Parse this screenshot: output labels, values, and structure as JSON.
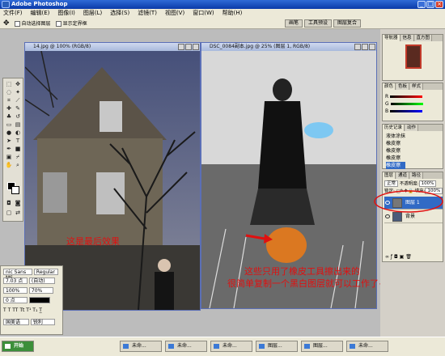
{
  "app": {
    "title": "Adobe Photoshop"
  },
  "menu": [
    "文件(F)",
    "编辑(E)",
    "图像(I)",
    "图层(L)",
    "选择(S)",
    "滤镜(T)",
    "视图(V)",
    "窗口(W)",
    "帮助(H)"
  ],
  "options_bar": {
    "option1": "自动选择图层",
    "option2": "显示定界框"
  },
  "palette_well": [
    "画笔",
    "工具预设",
    "图层复合"
  ],
  "documents": [
    {
      "title": "14.jpg @ 100% (RGB/8)"
    },
    {
      "title": "DSC_0084副本.jpg @ 25% (图层 1, RGB/8)"
    }
  ],
  "captions": {
    "left": "这是最后效果",
    "right_line1": "这些只用了橡皮工具擦出来的",
    "right_line2": "很简单复制一个黑白图层就可以工作了~"
  },
  "character_panel": {
    "font": "nic Sans MS",
    "style": "Regular",
    "size": "7.03 点",
    "leading": "(自动)",
    "scale_v": "100%",
    "scale_h": "70%",
    "baseline": "0 点",
    "lang": "国美语",
    "aa": "锐利"
  },
  "navigator": {
    "tabs": [
      "导航器",
      "信息",
      "直方图"
    ]
  },
  "color_panel": {
    "tabs": [
      "颜色",
      "色板",
      "样式"
    ],
    "channels": [
      "R",
      "G",
      "B"
    ]
  },
  "history_panel": {
    "tabs": [
      "历史记录",
      "动作"
    ],
    "items": [
      "液体涂抹",
      "橡皮擦",
      "橡皮擦",
      "橡皮擦",
      "橡皮擦"
    ]
  },
  "layers_panel": {
    "tabs": [
      "图层",
      "通道",
      "路径"
    ],
    "blend_mode": "正常",
    "opacity_label": "不透明度:",
    "opacity": "100%",
    "lock_label": "锁定:",
    "fill_label": "填充:",
    "fill": "100%",
    "layers": [
      "图层 1",
      "背景"
    ]
  },
  "taskbar": [
    "开始",
    "未命...",
    "未命...",
    "未命...",
    "图层...",
    "图层...",
    "未命..."
  ],
  "colors": {
    "accent_red": "#e01010",
    "annotation_orange": "#e87a1a",
    "annotation_blue": "#7ec8f2"
  }
}
